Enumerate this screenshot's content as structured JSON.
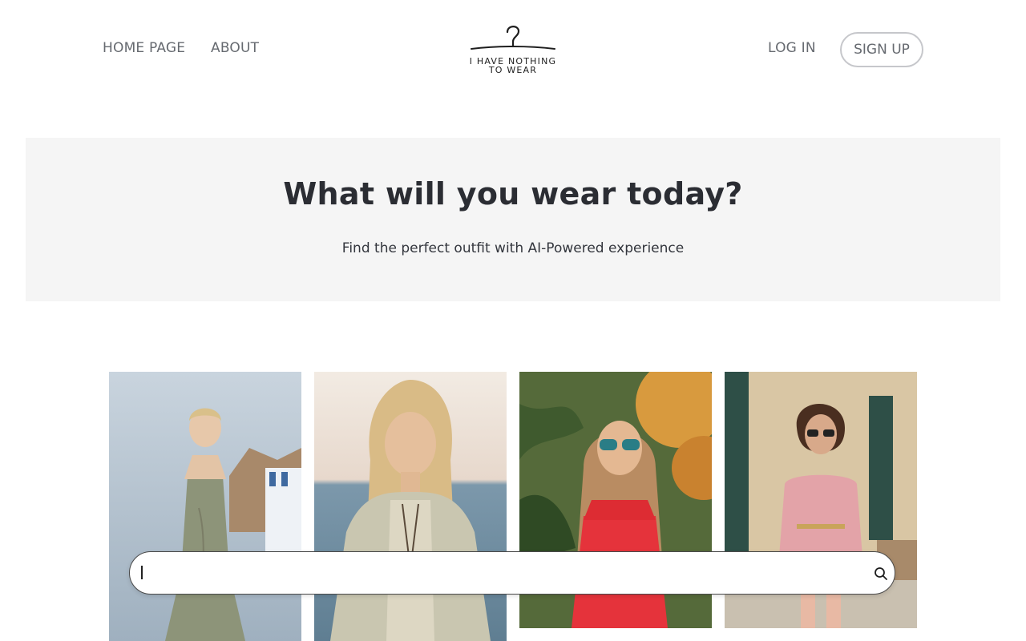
{
  "nav": {
    "home_label": "HOME PAGE",
    "about_label": "ABOUT",
    "login_label": "LOG IN",
    "signup_label": "SIGN UP"
  },
  "logo": {
    "line1": "I HAVE NOTHING",
    "line2": "TO WEAR",
    "icon": "hanger-icon"
  },
  "hero": {
    "title": "What will you wear today?",
    "subtitle": "Find the perfect outfit with AI-Powered experience"
  },
  "gallery": [
    {
      "icon": "outfit-photo",
      "palette": [
        "#c7d3de",
        "#a9926f",
        "#8f9a7f"
      ]
    },
    {
      "icon": "outfit-photo",
      "palette": [
        "#e9dfd6",
        "#6f8ea3",
        "#c5c0ad"
      ]
    },
    {
      "icon": "outfit-photo",
      "palette": [
        "#5b6a3c",
        "#d9a04b",
        "#e0343a"
      ]
    },
    {
      "icon": "outfit-photo",
      "palette": [
        "#d8c4a2",
        "#2f4a45",
        "#e3a3a8"
      ]
    }
  ],
  "search": {
    "placeholder": "",
    "value": "",
    "icon": "search-icon"
  },
  "colors": {
    "text_primary": "#2b2d33",
    "nav_text": "#666a70",
    "hero_bg": "#f5f5f5",
    "button_border": "#c6c7cb"
  }
}
